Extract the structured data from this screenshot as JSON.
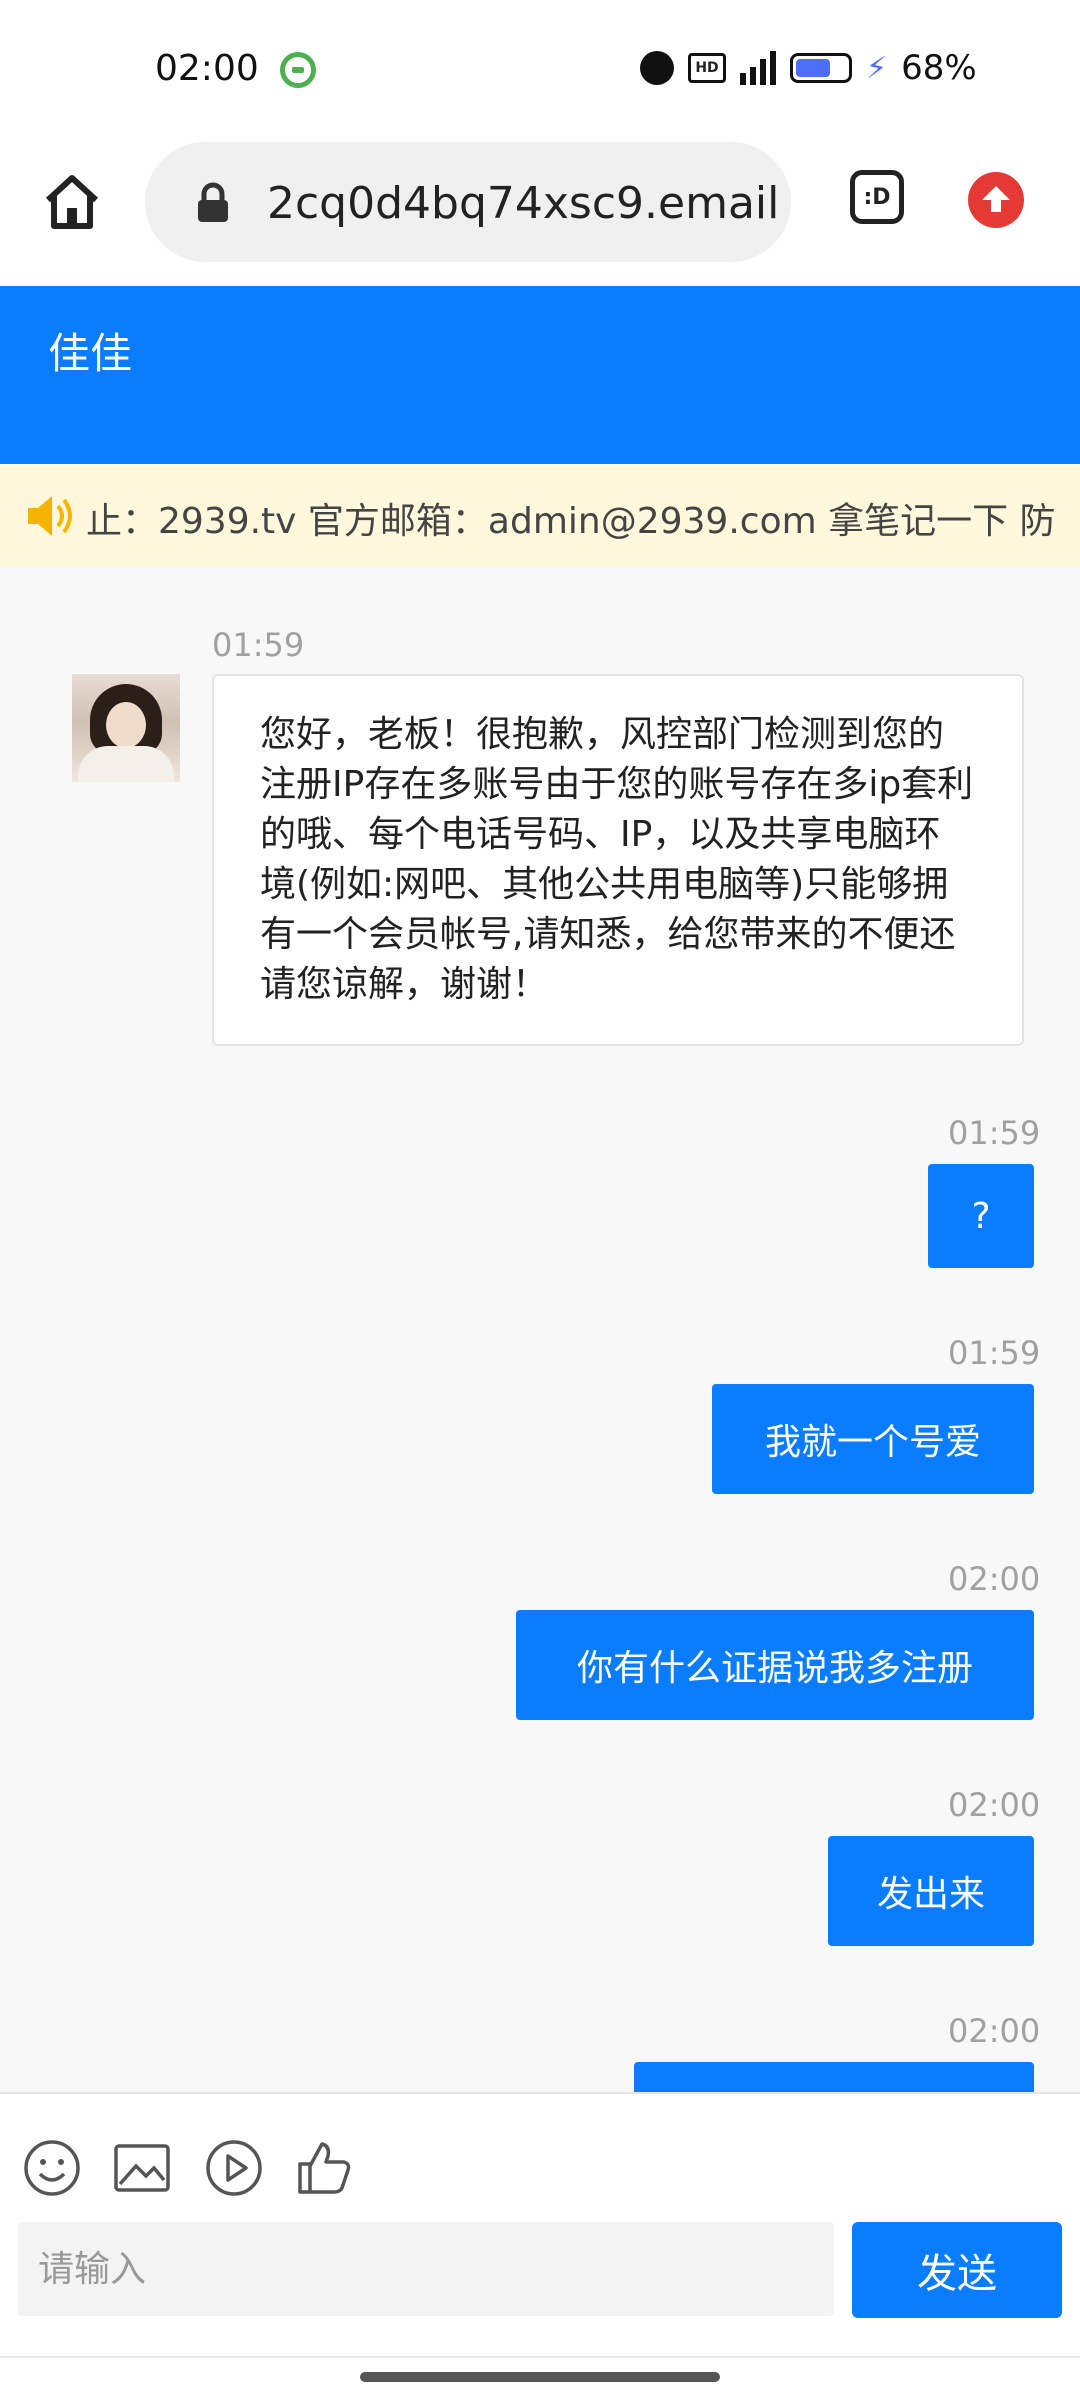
{
  "status_bar": {
    "time": "02:00",
    "battery_text": "68%",
    "battery_level": 0.68,
    "icons": [
      "pop-icon",
      "alarm-icon",
      "hd-icon",
      "5g-signal-icon",
      "battery-icon",
      "charging-icon"
    ]
  },
  "browser": {
    "url": "2cq0d4bq74xsc9.email",
    "tab_label": ":D"
  },
  "header": {
    "title": "佳佳"
  },
  "notice": {
    "text": "止：2939.tv 官方邮箱：admin@2939.com 拿笔记一下 防"
  },
  "messages": [
    {
      "direction": "in",
      "time": "01:59",
      "text": "您好，老板！很抱歉，风控部门检测到您的注册IP存在多账号由于您的账号存在多ip套利的哦、每个电话号码、IP，以及共享电脑环境(例如:网吧、其他公共用电脑等)只能够拥有一个会员帐号,请知悉，给您带来的不便还请您谅解，谢谢！"
    },
    {
      "direction": "out",
      "time": "01:59",
      "text": "?"
    },
    {
      "direction": "out",
      "time": "01:59",
      "text": "我就一个号爱"
    },
    {
      "direction": "out",
      "time": "02:00",
      "text": "你有什么证据说我多注册"
    },
    {
      "direction": "out",
      "time": "02:00",
      "text": "发出来"
    },
    {
      "direction": "out",
      "time": "02:00",
      "text": ""
    }
  ],
  "composer": {
    "placeholder": "请输入",
    "send_label": "发送",
    "tools": [
      "emoji-icon",
      "image-icon",
      "video-icon",
      "thumbs-up-icon"
    ]
  },
  "colors": {
    "accent": "#0a7cff",
    "notice_bg": "#fff8dc",
    "chat_bg": "#f8f8f8"
  }
}
